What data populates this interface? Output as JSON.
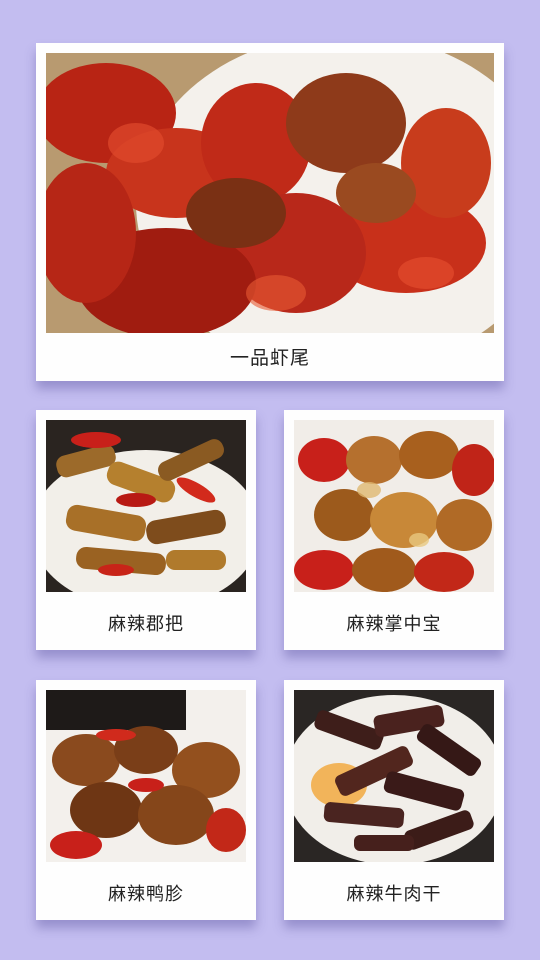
{
  "dishes": [
    {
      "name": "一品虾尾",
      "icon": "crayfish-tails-photo"
    },
    {
      "name": "麻辣郡把",
      "icon": "gizzard-photo"
    },
    {
      "name": "麻辣掌中宝",
      "icon": "chicken-cartilage-photo"
    },
    {
      "name": "麻辣鸭胗",
      "icon": "duck-gizzard-photo"
    },
    {
      "name": "麻辣牛肉干",
      "icon": "beef-jerky-photo"
    }
  ],
  "colors": {
    "background": "#c3bdf0",
    "card": "#fefefe",
    "chili": "#c8201a",
    "sauce": "#7a3a14"
  }
}
